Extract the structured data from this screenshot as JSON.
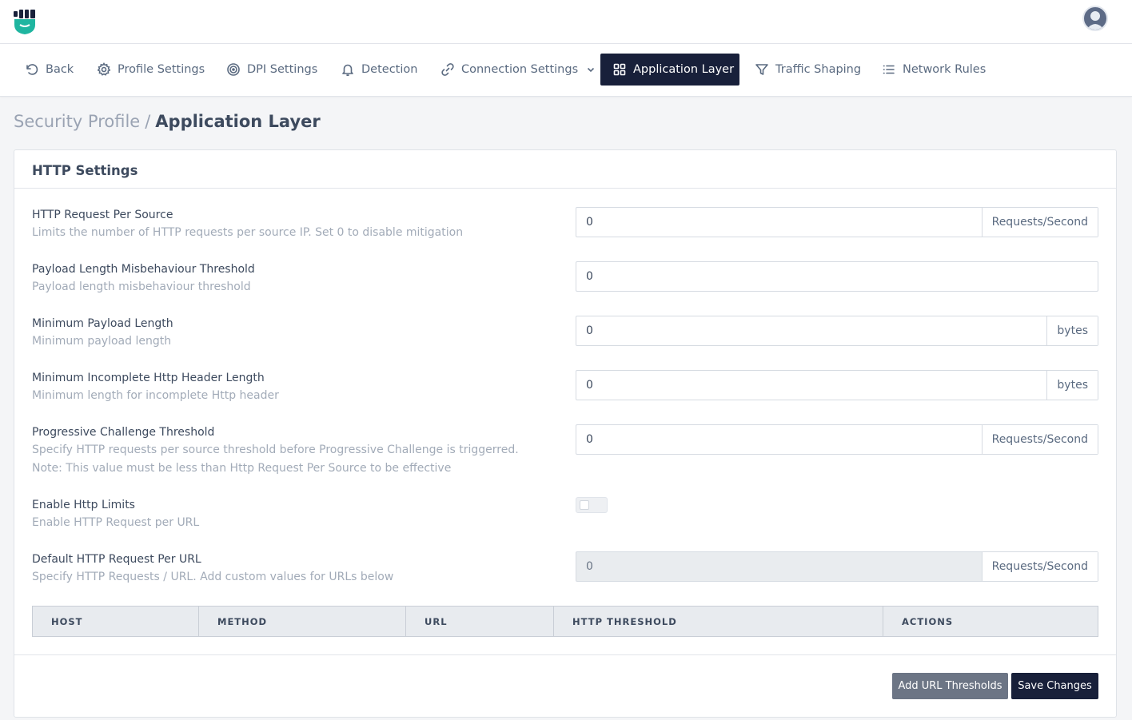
{
  "nav": {
    "back": "Back",
    "profile_settings": "Profile Settings",
    "dpi_settings": "DPI Settings",
    "detection": "Detection",
    "connection_settings": "Connection Settings",
    "application_layer": "Application Layer",
    "traffic_shaping": "Traffic Shaping",
    "network_rules": "Network Rules"
  },
  "breadcrumb": {
    "parent": "Security Profile",
    "separator": "/",
    "current": "Application Layer"
  },
  "card": {
    "title": "HTTP Settings"
  },
  "fields": {
    "http_request_per_source": {
      "label": "HTTP Request Per Source",
      "help": "Limits the number of HTTP requests per source IP. Set 0 to disable mitigation",
      "value": "0",
      "unit": "Requests/Second"
    },
    "payload_misbehaviour": {
      "label": "Payload Length Misbehaviour Threshold",
      "help": "Payload length misbehaviour threshold",
      "value": "0"
    },
    "min_payload_length": {
      "label": "Minimum Payload Length",
      "help": "Minimum payload length",
      "value": "0",
      "unit": "bytes"
    },
    "min_incomplete_header": {
      "label": "Minimum Incomplete Http Header Length",
      "help": "Minimum length for incomplete Http header",
      "value": "0",
      "unit": "bytes"
    },
    "progressive_challenge": {
      "label": "Progressive Challenge Threshold",
      "help_line1": "Specify HTTP requests per source threshold before Progressive Challenge is triggerred.",
      "help_line2": "Note: This value must be less than Http Request Per Source to be effective",
      "value": "0",
      "unit": "Requests/Second"
    },
    "enable_http_limits": {
      "label": "Enable Http Limits",
      "help": "Enable HTTP Request per URL",
      "enabled": false
    },
    "default_per_url": {
      "label": "Default HTTP Request Per URL",
      "help": "Specify HTTP Requests / URL. Add custom values for URLs below",
      "value": "0",
      "unit": "Requests/Second"
    }
  },
  "table": {
    "headers": [
      "HOST",
      "METHOD",
      "URL",
      "HTTP THRESHOLD",
      "ACTIONS"
    ]
  },
  "buttons": {
    "add_url_thresholds": "Add URL Thresholds",
    "save_changes": "Save Changes"
  },
  "colors": {
    "accent_dark": "#18203a",
    "logo_teal": "#1fb5a0",
    "secondary_button": "#6c7585"
  }
}
